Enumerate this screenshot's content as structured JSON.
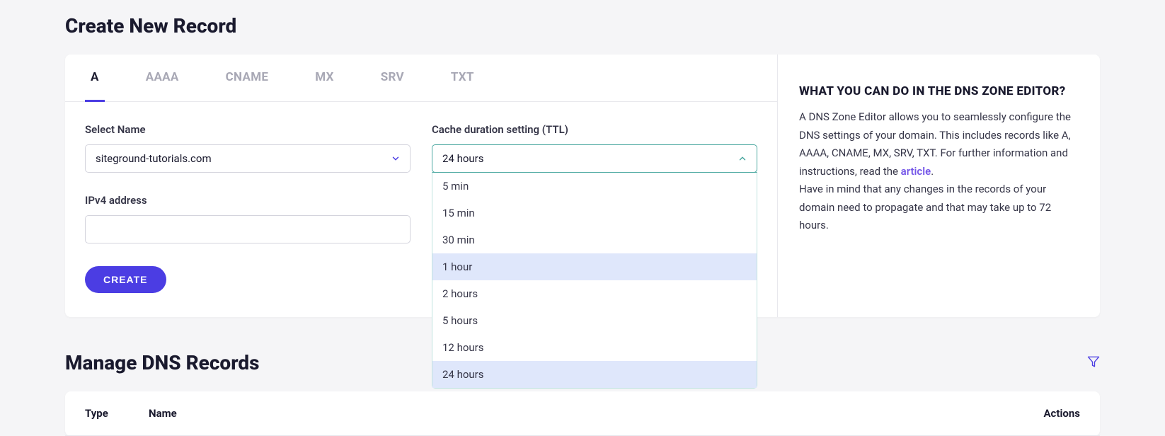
{
  "page": {
    "create_title": "Create New Record",
    "manage_title": "Manage DNS Records"
  },
  "tabs": {
    "items": [
      {
        "label": "A",
        "active": true
      },
      {
        "label": "AAAA",
        "active": false
      },
      {
        "label": "CNAME",
        "active": false
      },
      {
        "label": "MX",
        "active": false
      },
      {
        "label": "SRV",
        "active": false
      },
      {
        "label": "TXT",
        "active": false
      }
    ]
  },
  "form": {
    "name_label": "Select Name",
    "name_value": "siteground-tutorials.com",
    "ttl_label": "Cache duration setting (TTL)",
    "ttl_value": "24 hours",
    "ttl_options": [
      {
        "label": "5 min"
      },
      {
        "label": "15 min"
      },
      {
        "label": "30 min"
      },
      {
        "label": "1 hour"
      },
      {
        "label": "2 hours"
      },
      {
        "label": "5 hours"
      },
      {
        "label": "12 hours"
      },
      {
        "label": "24 hours"
      }
    ],
    "ipv4_label": "IPv4 address",
    "ipv4_value": "",
    "create_button": "CREATE"
  },
  "info": {
    "title": "WHAT YOU CAN DO IN THE DNS ZONE EDITOR?",
    "text_1": "A DNS Zone Editor allows you to seamlessly configure the DNS settings of your domain. This includes records like A, AAAA, CNAME, MX, SRV, TXT. For further information and instructions, read the ",
    "link_text": "article",
    "text_1_end": ".",
    "text_2": "Have in mind that any changes in the records of your domain need to propagate and that may take up to 72 hours."
  },
  "table": {
    "columns": {
      "type": "Type",
      "name": "Name",
      "actions": "Actions"
    }
  }
}
